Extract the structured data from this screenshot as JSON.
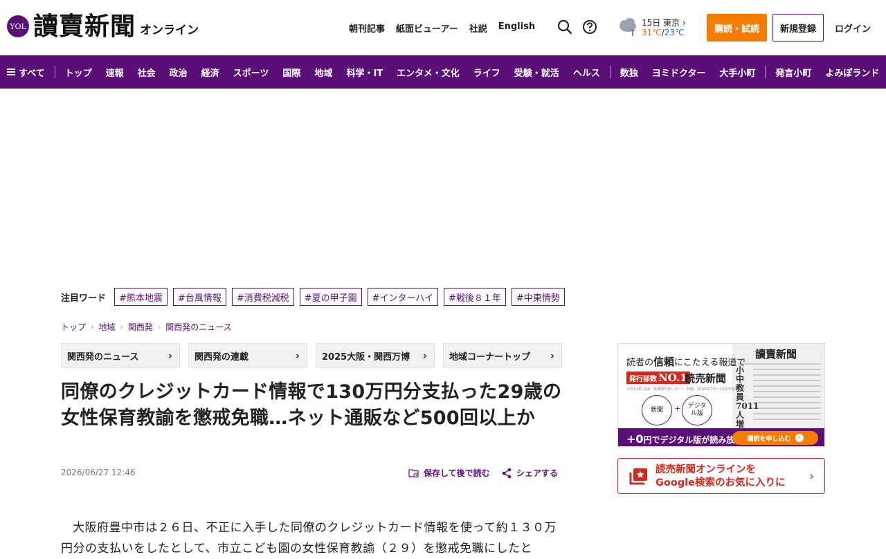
{
  "brand": {
    "badge": "YOL",
    "name": "讀賣新聞",
    "suffix": "オンライン"
  },
  "top_links": [
    "朝刊記事",
    "紙面ビューアー",
    "社説",
    "English"
  ],
  "weather": {
    "date_city": "15日 東京",
    "high": "31℃",
    "separator": "/",
    "low": "23℃"
  },
  "buttons": {
    "subscribe": "購読・試読",
    "register": "新規登録",
    "login": "ログイン"
  },
  "nav": {
    "all": "すべて",
    "items": [
      "トップ",
      "速報",
      "社会",
      "政治",
      "経済",
      "スポーツ",
      "国際",
      "地域",
      "科学・IT",
      "エンタメ・文化",
      "ライフ",
      "受験・就活",
      "ヘルス"
    ],
    "items2": [
      "数独",
      "ヨミドクター",
      "大手小町"
    ],
    "items3": [
      "発言小町",
      "よみぽランド"
    ]
  },
  "trending": {
    "label": "注目ワード",
    "tags": [
      "#熊本地震",
      "#台風情報",
      "#消費税減税",
      "#夏の甲子園",
      "#インターハイ",
      "#戦後８１年",
      "#中東情勢"
    ]
  },
  "breadcrumb": [
    "トップ",
    "地域",
    "関西発",
    "関西発のニュース"
  ],
  "sections": [
    "関西発のニュース",
    "関西発の連載",
    "2025大阪・関西万博",
    "地域コーナートップ"
  ],
  "article": {
    "headline": "同僚のクレジットカード情報で130万円分支払った29歳の女性保育教諭を懲戒免職…ネット通販など500回以上か",
    "date": "2026/06/27 12:46",
    "save_label": "保存して後で読む",
    "share_label": "シェアする",
    "body": "大阪府豊中市は２６日、不正に入手した同僚のクレジットカード情報を使って約１３０万円分の支払いをしたとして、市立こども園の女性保育教諭（２９）を懲戒免職にしたと"
  },
  "ad": {
    "paper_title": "讀賣新聞",
    "paper_headline": "小中教員7011人増",
    "line1_a": "読者の",
    "line1_b": "信頼",
    "line1_c": "にこたえる報道で",
    "no1_prefix": "発行部数",
    "no1": "NO.1",
    "line2": "読売新聞",
    "fine_print": "※日本ABC協会「新聞発行社レポート 半期」（2025年7月〜12月平均）より",
    "circle1": "新聞",
    "plus": "+",
    "circle2": "デジタル版",
    "bar_prefix": "+0",
    "bar_text": "円でデジタル版が読み放題！",
    "cta": "購読を申し込む"
  },
  "google_cta": {
    "line1": "読売新聞オンラインを",
    "line2": "Google検索のお気に入りに"
  },
  "colors": {
    "brand_purple": "#5a0f78",
    "orange": "#f57c00",
    "red": "#d4281c"
  }
}
